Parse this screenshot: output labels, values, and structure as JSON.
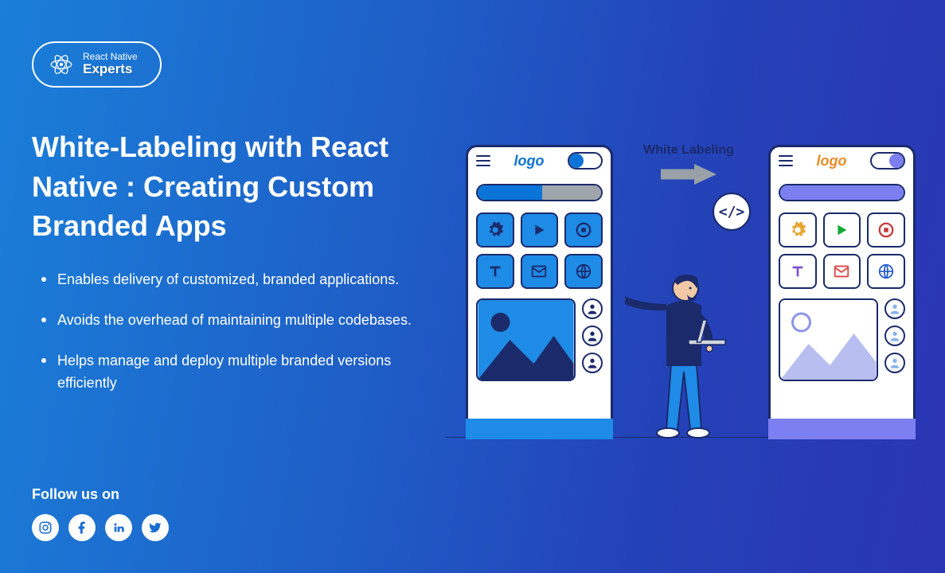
{
  "brand": {
    "sub": "React Native",
    "main": "Experts"
  },
  "title": "White-Labeling with React Native : Creating Custom Branded Apps",
  "bullets": [
    "Enables delivery of customized, branded applications.",
    "Avoids the overhead of maintaining multiple codebases.",
    "Helps manage and deploy multiple branded versions efficiently"
  ],
  "follow_label": "Follow us on",
  "illustration": {
    "arrow_label": "White Labeling",
    "code_symbol": "</>",
    "phone_logo_left": "logo",
    "phone_logo_right": "logo"
  },
  "social_icons": [
    "instagram",
    "facebook",
    "linkedin",
    "twitter"
  ]
}
